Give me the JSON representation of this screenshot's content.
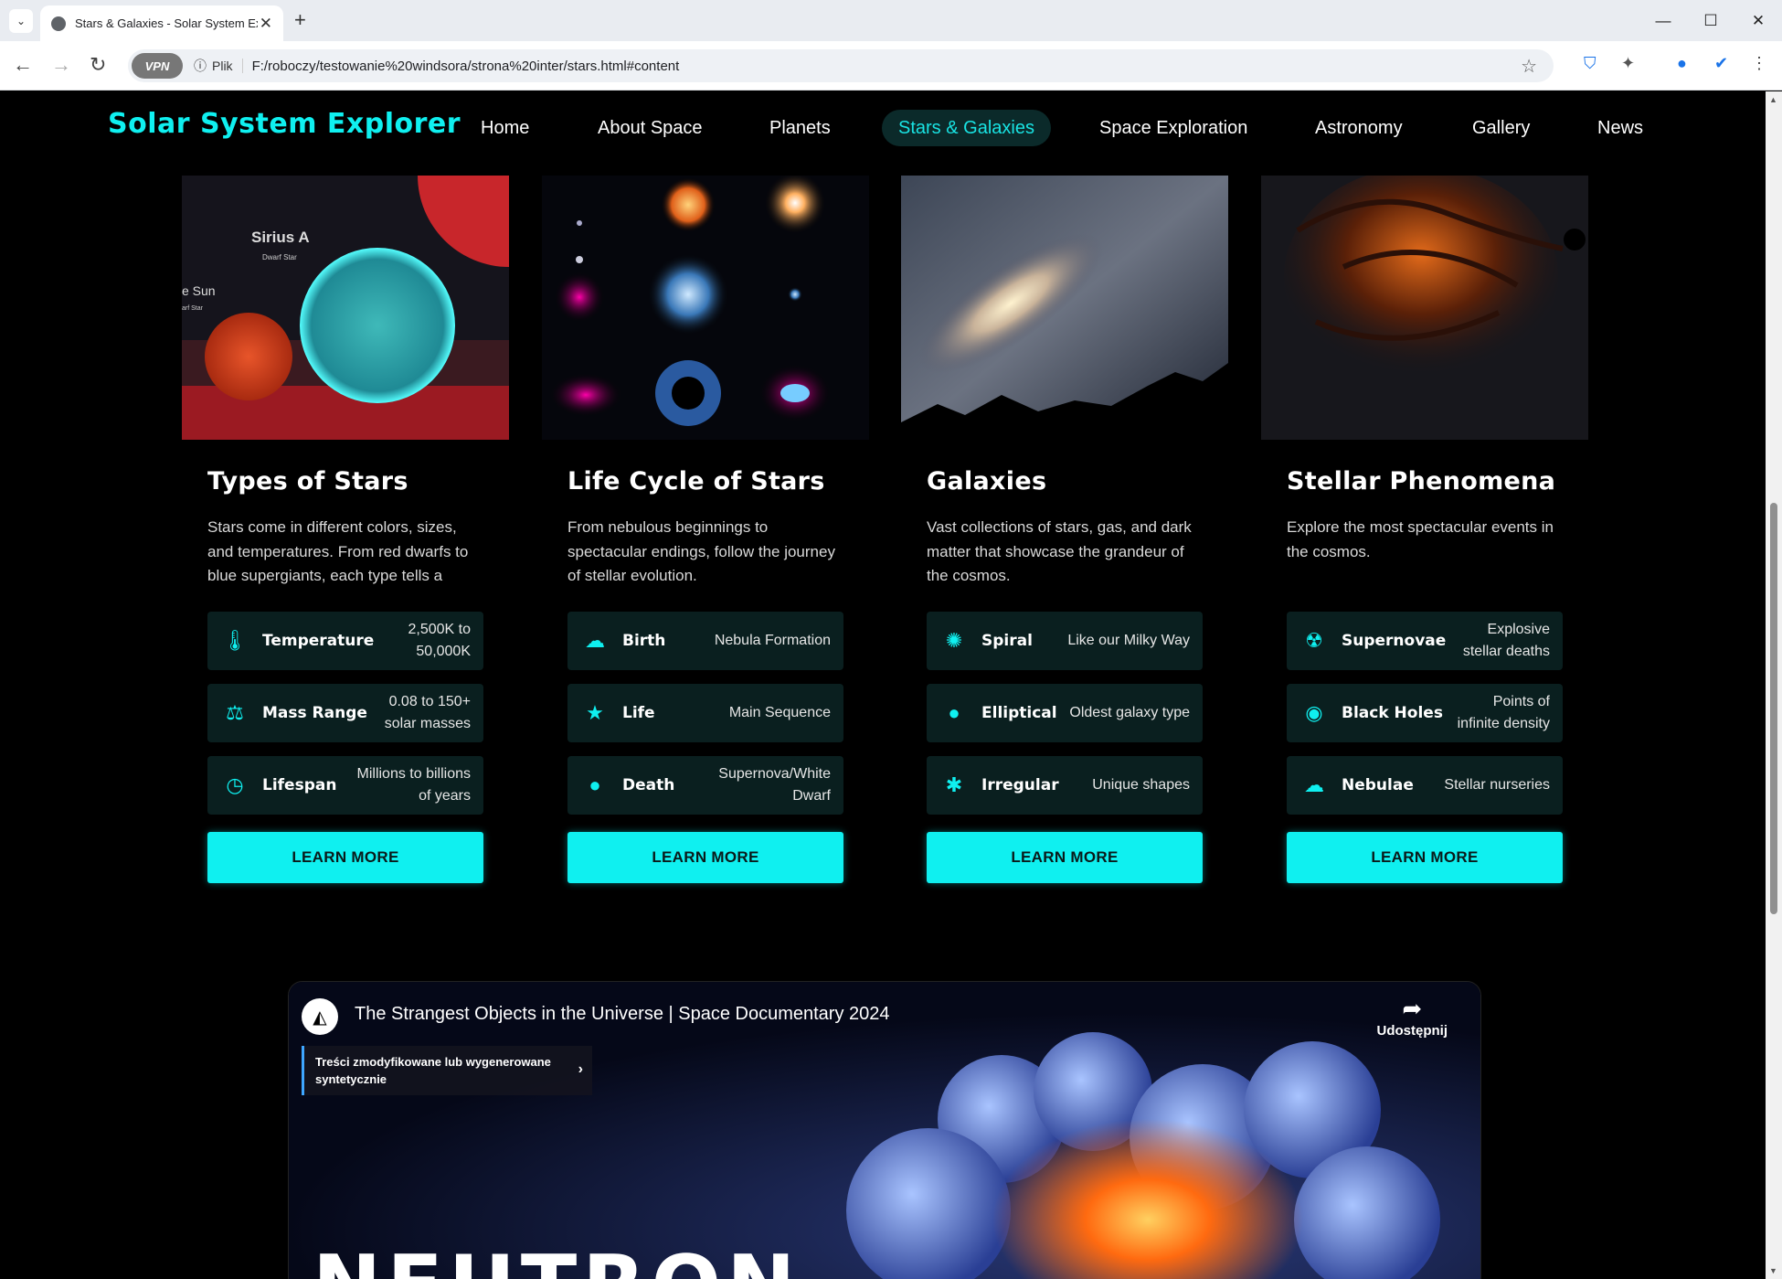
{
  "browser": {
    "tab_title": "Stars & Galaxies - Solar System Explorer",
    "url": "F:/roboczy/testowanie%20windsora/strona%20inter/stars.html#content",
    "file_label": "Plik",
    "vpn_label": "VPN",
    "new_tab": "+",
    "close": "✕"
  },
  "site": {
    "logo": "Solar System Explorer",
    "nav": [
      "Home",
      "About Space",
      "Planets",
      "Stars & Galaxies",
      "Space Exploration",
      "Astronomy",
      "Gallery",
      "News"
    ],
    "active_nav": "Stars & Galaxies"
  },
  "cards": [
    {
      "title": "Types of Stars",
      "desc": "Stars come in different colors, sizes, and temperatures. From red dwarfs to blue supergiants, each type tells a",
      "image_labels": {
        "a": "Sirius A",
        "a_sub": "Dwarf Star",
        "b": "e Sun",
        "b_sub": "arf Star"
      },
      "features": [
        {
          "icon": "thermometer-icon",
          "glyph": "🌡",
          "label": "Temperature",
          "value": "2,500K to 50,000K"
        },
        {
          "icon": "weight-icon",
          "glyph": "⚖",
          "label": "Mass Range",
          "value": "0.08 to 150+ solar masses"
        },
        {
          "icon": "clock-icon",
          "glyph": "◷",
          "label": "Lifespan",
          "value": "Millions to billions of years"
        }
      ],
      "button": "LEARN MORE"
    },
    {
      "title": "Life Cycle of Stars",
      "desc": "From nebulous beginnings to spectacular endings, follow the journey of stellar evolution.",
      "features": [
        {
          "icon": "cloud-icon",
          "glyph": "☁",
          "label": "Birth",
          "value": "Nebula Formation"
        },
        {
          "icon": "star-icon",
          "glyph": "★",
          "label": "Life",
          "value": "Main Sequence"
        },
        {
          "icon": "bomb-icon",
          "glyph": "●",
          "label": "Death",
          "value": "Supernova/White Dwarf"
        }
      ],
      "button": "LEARN MORE"
    },
    {
      "title": "Galaxies",
      "desc": "Vast collections of stars, gas, and dark matter that showcase the grandeur of the cosmos.",
      "features": [
        {
          "icon": "sun-icon",
          "glyph": "✺",
          "label": "Spiral",
          "value": "Like our Milky Way"
        },
        {
          "icon": "circle-icon",
          "glyph": "●",
          "label": "Elliptical",
          "value": "Oldest galaxy type"
        },
        {
          "icon": "asterisk-icon",
          "glyph": "✱",
          "label": "Irregular",
          "value": "Unique shapes"
        }
      ],
      "button": "LEARN MORE"
    },
    {
      "title": "Stellar Phenomena",
      "desc": "Explore the most spectacular events in the cosmos.",
      "features": [
        {
          "icon": "radiation-icon",
          "glyph": "☢",
          "label": "Supernovae",
          "value": "Explosive stellar deaths"
        },
        {
          "icon": "dot-circle-icon",
          "glyph": "◉",
          "label": "Black Holes",
          "value": "Points of infinite density"
        },
        {
          "icon": "cloud-icon",
          "glyph": "☁",
          "label": "Nebulae",
          "value": "Stellar nurseries"
        }
      ],
      "button": "LEARN MORE"
    }
  ],
  "video": {
    "title": "The Strangest Objects in the Universe | Space Documentary 2024",
    "share": "Udostępnij",
    "notice": "Treści zmodyfikowane lub wygenerowane syntetycznie",
    "overlay_text": "NEUTRON"
  },
  "colors": {
    "accent": "#0ff0f0",
    "feature_bg": "#0a1f1f",
    "nav_active_bg": "#0b2a2a"
  }
}
